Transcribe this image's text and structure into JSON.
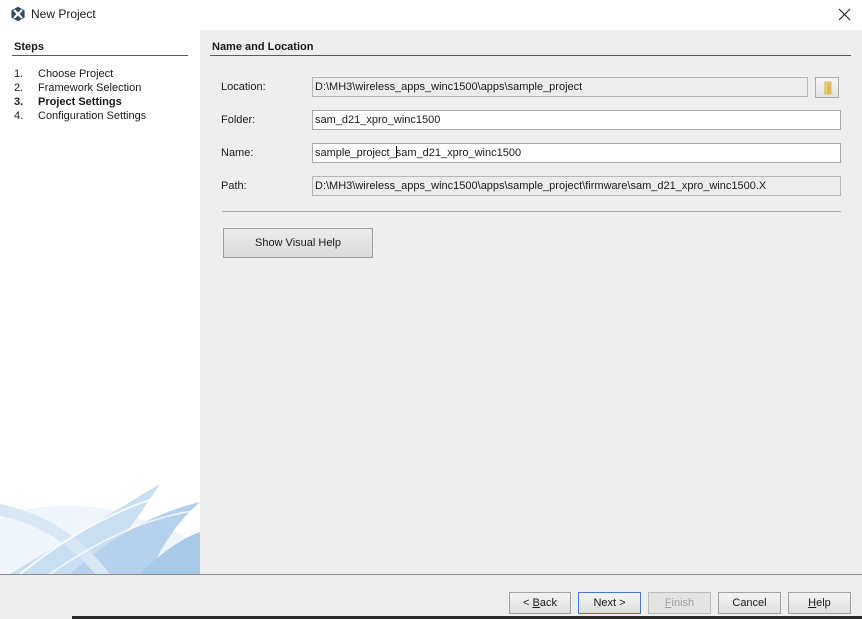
{
  "window": {
    "title": "New Project"
  },
  "steps": {
    "title": "Steps",
    "items": [
      {
        "num": "1.",
        "label": "Choose Project",
        "active": false
      },
      {
        "num": "2.",
        "label": "Framework Selection",
        "active": false
      },
      {
        "num": "3.",
        "label": "Project Settings",
        "active": true
      },
      {
        "num": "4.",
        "label": "Configuration Settings",
        "active": false
      }
    ]
  },
  "section": {
    "title": "Name and Location"
  },
  "form": {
    "location": {
      "label": "Location:",
      "value": "D:\\MH3\\wireless_apps_winc1500\\apps\\sample_project"
    },
    "folder": {
      "label": "Folder:",
      "value": "sam_d21_xpro_winc1500"
    },
    "name": {
      "label": "Name:",
      "value_before_caret": "sample_project_",
      "value_after_caret": "sam_d21_xpro_winc1500"
    },
    "path": {
      "label": "Path:",
      "value": "D:\\MH3\\wireless_apps_winc1500\\apps\\sample_project\\firmware\\sam_d21_xpro_winc1500.X"
    }
  },
  "visual_help_label": "Show Visual Help",
  "buttons": {
    "back": {
      "mnemonic_pre": "< ",
      "mnemonic": "B",
      "rest": "ack"
    },
    "next": {
      "label": "Next >"
    },
    "finish": {
      "mnemonic": "F",
      "rest": "inish"
    },
    "cancel": {
      "label": "Cancel"
    },
    "help": {
      "mnemonic": "H",
      "rest": "elp"
    }
  },
  "colors": {
    "content_bg": "#eeeeee",
    "default_button_border": "#3a7bd5",
    "swoosh": "#bcd7ef"
  },
  "icons": {
    "app": "netbeans-icon",
    "close": "close-icon",
    "browse": "folder-icon"
  }
}
